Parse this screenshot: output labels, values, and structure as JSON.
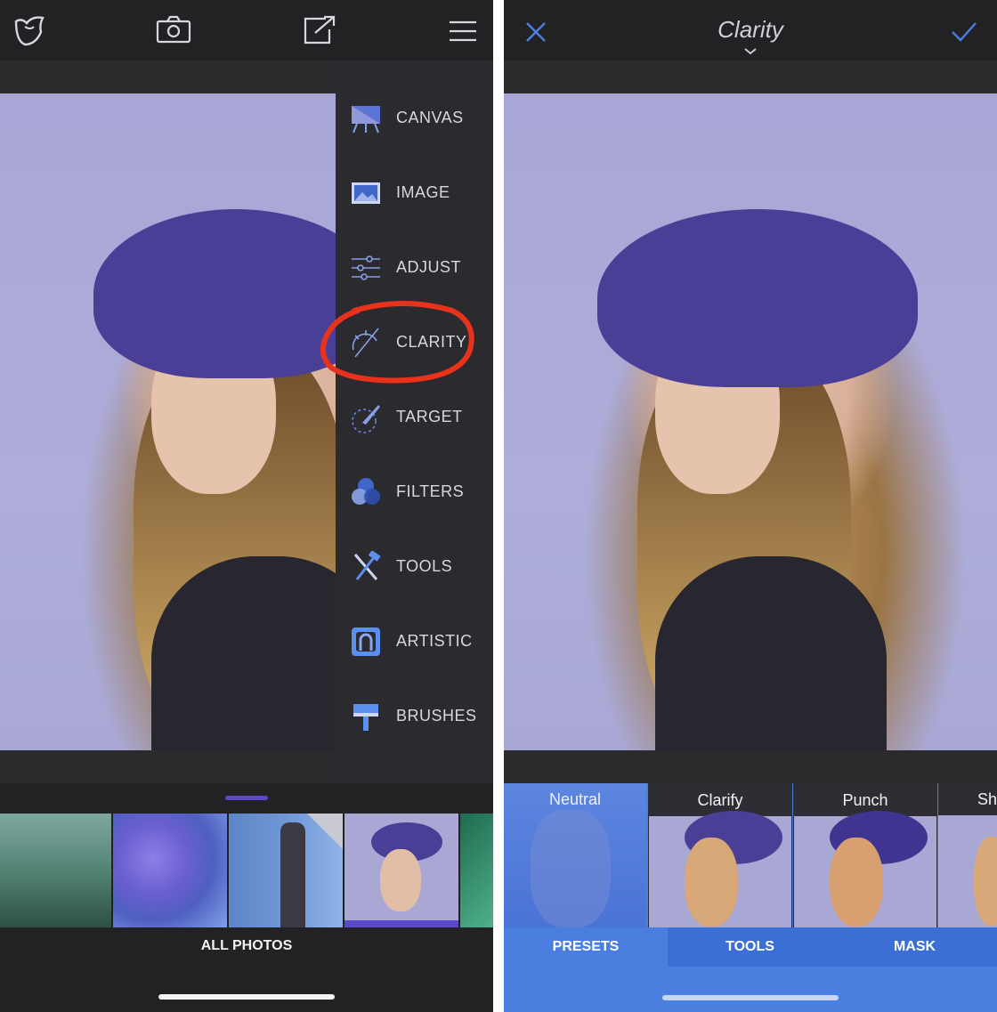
{
  "left": {
    "side_menu": {
      "items": [
        {
          "label": "CANVAS",
          "icon": "canvas-easel-icon"
        },
        {
          "label": "IMAGE",
          "icon": "image-icon"
        },
        {
          "label": "ADJUST",
          "icon": "adjust-sliders-icon"
        },
        {
          "label": "CLARITY",
          "icon": "clarity-icon"
        },
        {
          "label": "TARGET",
          "icon": "target-brush-icon"
        },
        {
          "label": "FILTERS",
          "icon": "filters-circles-icon"
        },
        {
          "label": "TOOLS",
          "icon": "tools-hammer-icon"
        },
        {
          "label": "ARTISTIC",
          "icon": "artistic-stamp-icon"
        },
        {
          "label": "BRUSHES",
          "icon": "brushes-roller-icon"
        }
      ],
      "highlight_color": "#e8321c"
    },
    "album_label": "ALL PHOTOS"
  },
  "right": {
    "title": "Clarity",
    "accent_color": "#4a7fe0",
    "presets": [
      {
        "label": "Neutral"
      },
      {
        "label": "Clarify"
      },
      {
        "label": "Punch"
      },
      {
        "label": "Sh"
      }
    ],
    "tabs": [
      {
        "label": "PRESETS"
      },
      {
        "label": "TOOLS"
      },
      {
        "label": "MASK"
      }
    ]
  }
}
